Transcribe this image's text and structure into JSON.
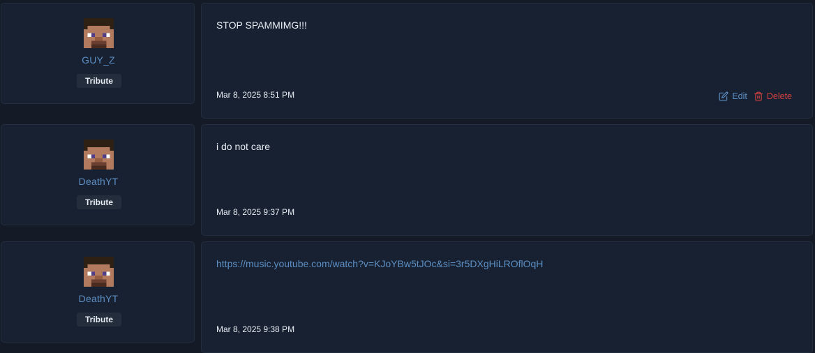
{
  "posts": [
    {
      "author": "GUY_Z",
      "rank": "Tribute",
      "avatar_icon": "minecraft-steve-avatar",
      "message": "STOP SPAMMIMG!!!",
      "timestamp": "Mar 8, 2025 8:51 PM",
      "edit_label": "Edit",
      "delete_label": "Delete"
    },
    {
      "author": "DeathYT",
      "rank": "Tribute",
      "avatar_icon": "minecraft-steve-avatar",
      "message": "i do not care",
      "timestamp": "Mar 8, 2025 9:37 PM"
    },
    {
      "author": "DeathYT",
      "rank": "Tribute",
      "avatar_icon": "minecraft-steve-avatar",
      "message": "https://music.youtube.com/watch?v=KJoYBw5tJOc&si=3r5DXgHiLROflOqH",
      "message_is_link": true,
      "timestamp": "Mar 8, 2025 9:38 PM"
    }
  ],
  "colors": {
    "page_bg": "#141b27",
    "card_bg": "#172131",
    "card_border": "#222d3d",
    "link": "#5d8fc4",
    "delete": "#d6413f",
    "text": "#e8edf4",
    "badge_bg": "#232d3c"
  },
  "icons": {
    "edit": "pencil-square-icon",
    "delete": "trash-icon"
  }
}
